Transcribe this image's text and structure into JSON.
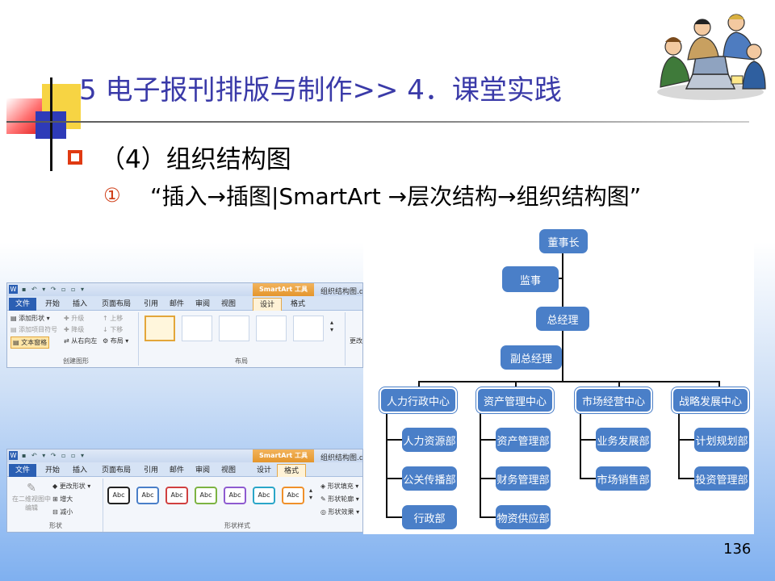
{
  "slide": {
    "title": "5 电子报刊排版与制作>> 4．课堂实践",
    "bullet_heading": "（4）组织结构图",
    "sub_number": "①",
    "sub_text": "“插入→插图|SmartArt →层次结构→组织结构图”",
    "page_number": "136"
  },
  "ribbon_design": {
    "tools_label": "SmartArt 工具",
    "doc_title": "组织结构图.doc",
    "tabs": [
      "文件",
      "开始",
      "插入",
      "页面布局",
      "引用",
      "邮件",
      "审阅",
      "视图",
      "设计",
      "格式"
    ],
    "active_tab": "设计",
    "commands": {
      "add_shape": "添加形状",
      "add_bullet": "添加项目符号",
      "text_pane": "文本窗格",
      "promote": "升级",
      "demote": "降级",
      "right_to_left": "从右向左",
      "move_up": "上移",
      "move_down": "下移",
      "layout": "布局",
      "change_colors": "更改"
    },
    "groups": {
      "create_graphic": "创建图形",
      "layouts": "布局"
    }
  },
  "ribbon_format": {
    "tools_label": "SmartArt 工具",
    "doc_title": "组织结构图.doc",
    "tabs": [
      "文件",
      "开始",
      "插入",
      "页面布局",
      "引用",
      "邮件",
      "审阅",
      "视图",
      "设计",
      "格式"
    ],
    "active_tab": "格式",
    "commands": {
      "edit_in_2d_line1": "在二维视图中",
      "edit_in_2d_line2": "编辑",
      "change_shape": "更改形状",
      "larger": "增大",
      "smaller": "减小",
      "shape_fill": "形状填充",
      "shape_outline": "形状轮廓",
      "shape_effects": "形状效果"
    },
    "style_boxes": [
      "Abc",
      "Abc",
      "Abc",
      "Abc",
      "Abc",
      "Abc",
      "Abc"
    ],
    "style_colors": [
      "#222222",
      "#4a7fc8",
      "#d04040",
      "#7cb342",
      "#8e5bd0",
      "#2aa6c8",
      "#f0902a"
    ],
    "groups": {
      "shapes": "形状",
      "shape_styles": "形状样式"
    }
  },
  "org_chart": {
    "chairman": "董事长",
    "supervisor": "监事",
    "general_manager": "总经理",
    "deputy_gm": "副总经理",
    "centers": [
      {
        "name": "人力行政中心",
        "departments": [
          "人力资源部",
          "公关传播部",
          "行政部"
        ]
      },
      {
        "name": "资产管理中心",
        "departments": [
          "资产管理部",
          "财务管理部",
          "物资供应部"
        ]
      },
      {
        "name": "市场经营中心",
        "departments": [
          "业务发展部",
          "市场销售部"
        ]
      },
      {
        "name": "战略发展中心",
        "departments": [
          "计划规划部",
          "投资管理部"
        ]
      }
    ],
    "node_color": "#4a7fc8"
  }
}
